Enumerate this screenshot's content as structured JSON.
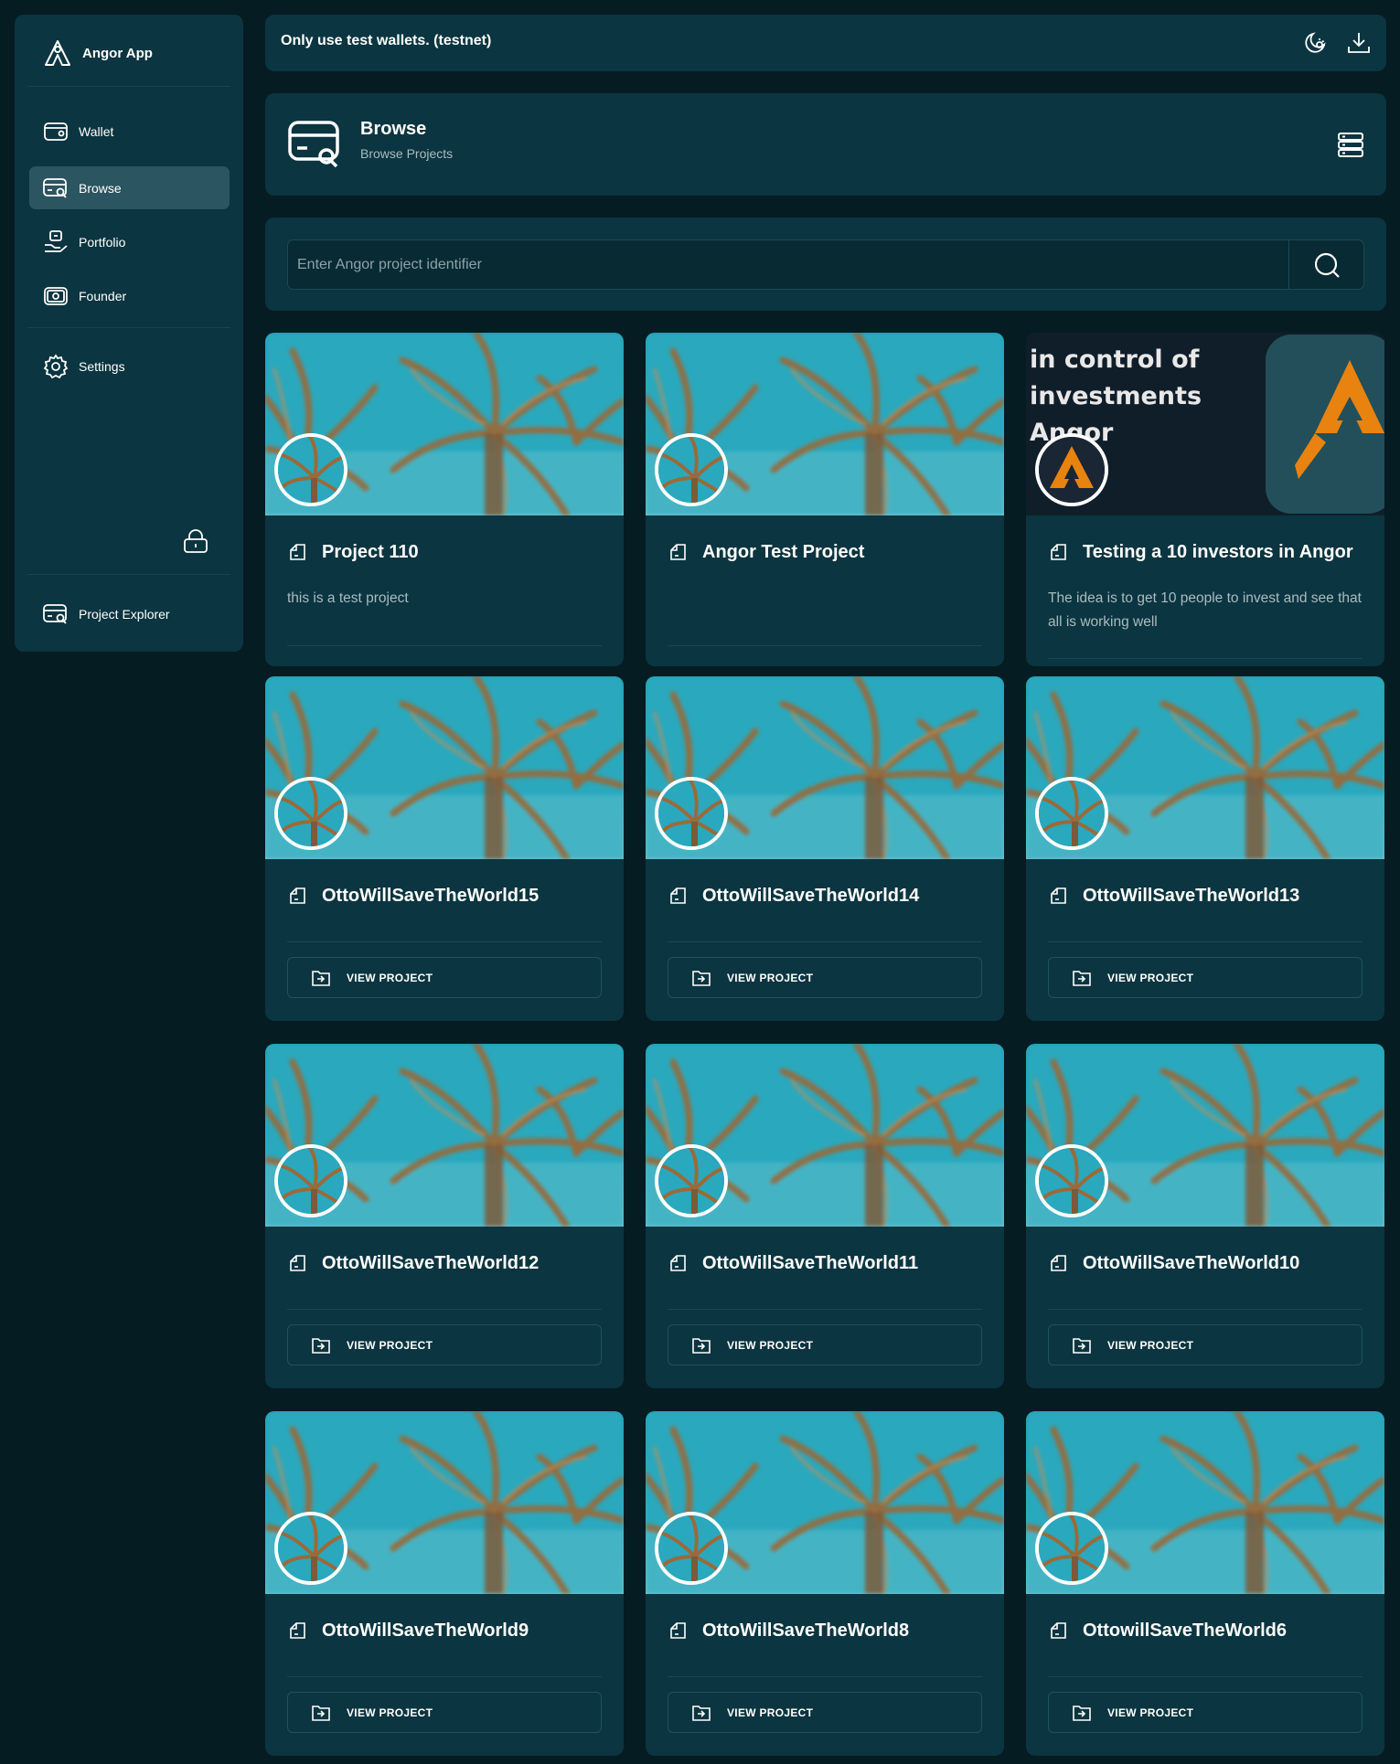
{
  "sidebar": {
    "brand": "Angor App",
    "items": [
      {
        "label": "Wallet",
        "icon": "wallet-icon"
      },
      {
        "label": "Browse",
        "icon": "browse-icon",
        "active": true
      },
      {
        "label": "Portfolio",
        "icon": "portfolio-icon"
      },
      {
        "label": "Founder",
        "icon": "founder-icon"
      },
      {
        "label": "Settings",
        "icon": "gear-icon"
      }
    ],
    "explorer_label": "Project Explorer"
  },
  "banner": {
    "text": "Only use test wallets. (testnet)"
  },
  "header": {
    "title": "Browse",
    "subtitle": "Browse Projects"
  },
  "search": {
    "placeholder": "Enter Angor project identifier",
    "value": ""
  },
  "cards": [
    {
      "title": "Project 110",
      "description": "this is a test project"
    },
    {
      "title": "Angor Test Project",
      "description": ""
    },
    {
      "title": "Testing a 10 investors in Angor",
      "description": "The idea is to get 10 people to invest and see that all is working well",
      "banner_text": "in control of investments Angor"
    },
    {
      "title": "OttoWillSaveTheWorld15",
      "button": "VIEW PROJECT"
    },
    {
      "title": "OttoWillSaveTheWorld14",
      "button": "VIEW PROJECT"
    },
    {
      "title": "OttoWillSaveTheWorld13",
      "button": "VIEW PROJECT"
    },
    {
      "title": "OttoWillSaveTheWorld12",
      "button": "VIEW PROJECT"
    },
    {
      "title": "OttoWillSaveTheWorld11",
      "button": "VIEW PROJECT"
    },
    {
      "title": "OttoWillSaveTheWorld10",
      "button": "VIEW PROJECT"
    },
    {
      "title": "OttoWillSaveTheWorld9",
      "button": "VIEW PROJECT"
    },
    {
      "title": "OttoWillSaveTheWorld8",
      "button": "VIEW PROJECT"
    },
    {
      "title": "OttowillSaveTheWorld6",
      "button": "VIEW PROJECT"
    }
  ],
  "colors": {
    "background": "#051c22",
    "panel": "#0b3540",
    "active_nav": "#2b5560",
    "accent_orange": "#e8830f"
  }
}
